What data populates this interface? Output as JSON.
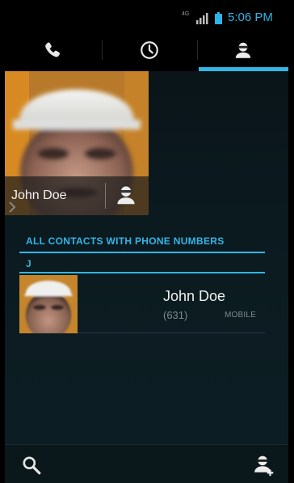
{
  "status_bar": {
    "network": "4G",
    "time": "5:06 PM",
    "accent": "#2cb4e8"
  },
  "tabs": [
    {
      "name": "phone",
      "icon": "phone-icon"
    },
    {
      "name": "recent",
      "icon": "clock-icon"
    },
    {
      "name": "contacts",
      "icon": "person-icon",
      "selected": true
    }
  ],
  "favorite": {
    "name": "John Doe"
  },
  "section_header": "ALL CONTACTS WITH PHONE NUMBERS",
  "letter_header": "J",
  "contacts": [
    {
      "name": "John Doe",
      "number": "(631)",
      "type": "MOBILE"
    }
  ],
  "bottom_bar": {
    "left_icon": "search-icon",
    "right_icon": "add-contact-icon"
  },
  "colors": {
    "accent": "#33b5e5",
    "background": "#0b1a1f"
  }
}
